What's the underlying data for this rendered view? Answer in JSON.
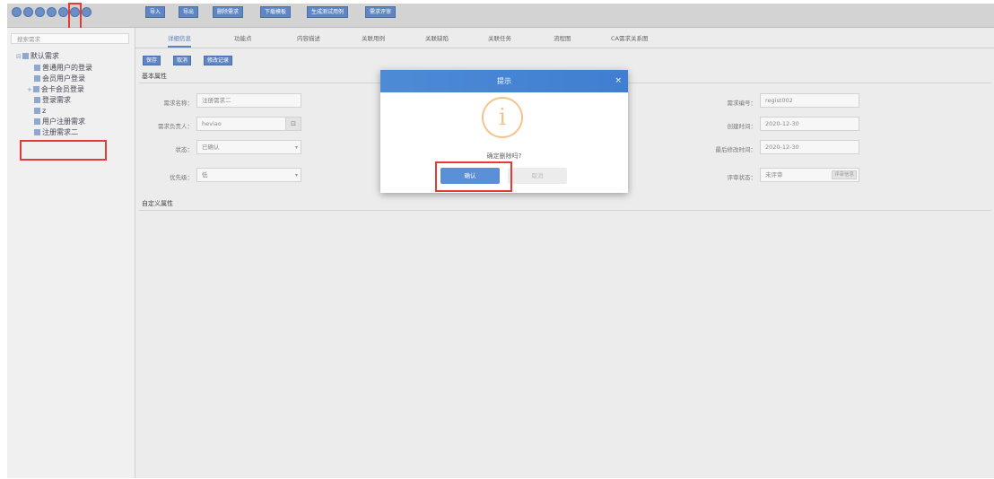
{
  "toolbar": {
    "circles": [
      "",
      "",
      "",
      "",
      "",
      "",
      ""
    ],
    "buttons": [
      "导入",
      "导出",
      "删除需求",
      "下载模板",
      "生成测试用例",
      "需求评审"
    ]
  },
  "sidebar": {
    "search_placeholder": "搜索需求",
    "items": [
      {
        "label": "默认需求",
        "toggle": "⊟"
      },
      {
        "label": "普通用户的登录"
      },
      {
        "label": "会员用户登录"
      },
      {
        "label": "会卡会员登录",
        "toggle": "+"
      },
      {
        "label": "登录需求"
      },
      {
        "label": "z"
      },
      {
        "label": "用户注册需求"
      },
      {
        "label": "注册需求二"
      }
    ]
  },
  "tabs": [
    "详细信息",
    "功能点",
    "内容描述",
    "关联用例",
    "关联缺陷",
    "关联任务",
    "流程图",
    "CA需求关系图"
  ],
  "actions": [
    "保存",
    "取消",
    "修改记录"
  ],
  "basic_section": {
    "title": "基本属性",
    "fields_left": [
      {
        "label": "需求名称：",
        "value": "注册需求二"
      },
      {
        "label": "需求负责人：",
        "value": "heviao",
        "icon": "lock-icon"
      },
      {
        "label": "状态：",
        "value": "已确认",
        "select": true
      },
      {
        "label": "优先级：",
        "value": "低",
        "select": true
      }
    ],
    "fields_right": [
      {
        "label": "需求编号：",
        "value": "regist002"
      },
      {
        "label": "创建时间：",
        "value": "2020-12-30"
      },
      {
        "label": "最后修改时间：",
        "value": "2020-12-30"
      },
      {
        "label": "评审状态：",
        "value": "未评审",
        "button": "评审信息"
      }
    ]
  },
  "custom_section": {
    "title": "自定义属性"
  },
  "dialog": {
    "title": "提示",
    "close": "×",
    "icon": "info-icon",
    "icon_glyph": "i",
    "message": "确定删除吗?",
    "ok": "确认",
    "cancel": "取消"
  },
  "colors": {
    "accent": "#5b8fd8",
    "highlight": "#e53b35"
  }
}
